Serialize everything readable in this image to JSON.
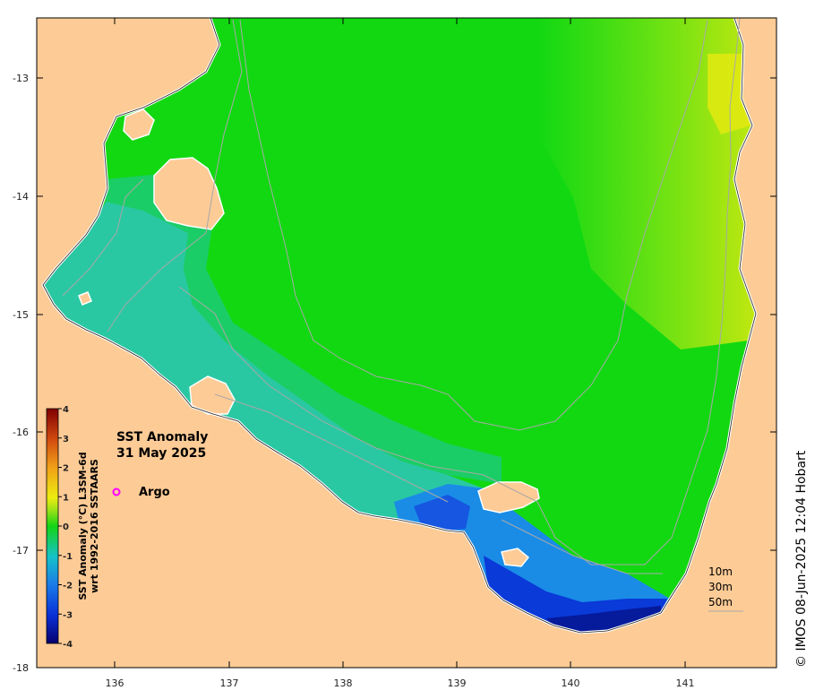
{
  "map": {
    "title_line1": "SST Anomaly",
    "title_line2": "31 May 2025",
    "argo_label": "Argo",
    "credit": "© IMOS 08-Jun-2025 12:04 Hobart",
    "colorbar_title_line1": "SST Anomaly (°C) L3SM-6d",
    "colorbar_title_line2": "wrt 1992-2016 SSTAARS",
    "colorbar_ticks": [
      "4",
      "3",
      "2",
      "1",
      "0",
      "-1",
      "-2",
      "-3",
      "-4"
    ],
    "x_ticks": [
      "136",
      "137",
      "138",
      "139",
      "140",
      "141"
    ],
    "y_ticks": [
      "-13",
      "-14",
      "-15",
      "-16",
      "-17",
      "-18"
    ],
    "depth_labels": [
      "10m",
      "30m",
      "50m"
    ],
    "colors": {
      "land": "#fdcb96",
      "argo_marker": "#ff00ff",
      "contour": "#a8a8a8"
    }
  }
}
